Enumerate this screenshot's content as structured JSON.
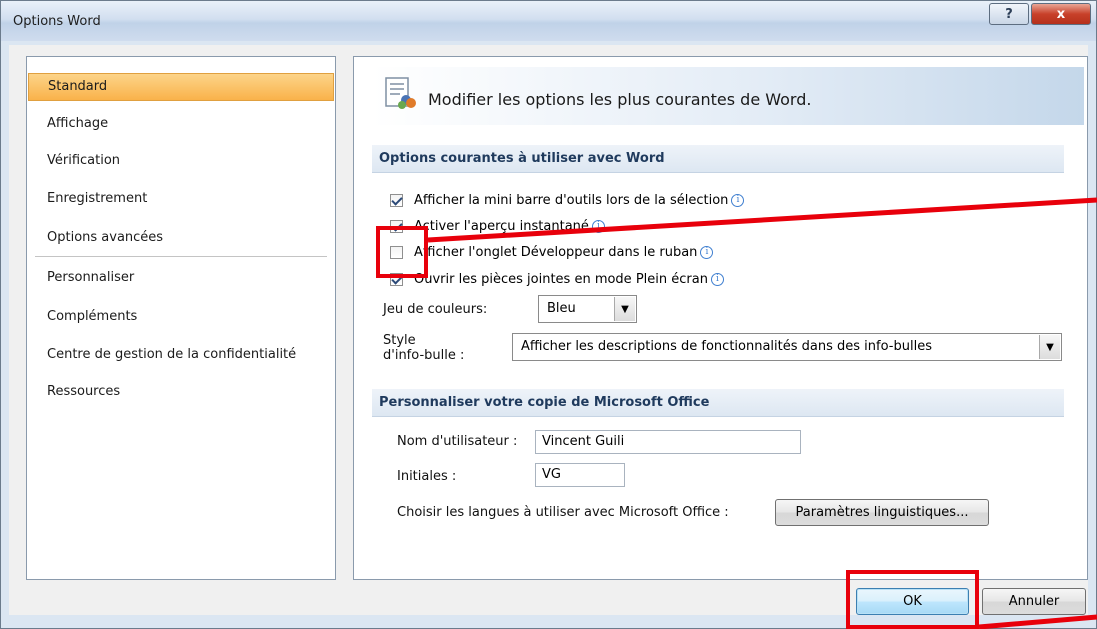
{
  "window": {
    "title": "Options Word",
    "help_glyph": "?",
    "close_glyph": "x"
  },
  "nav": {
    "items": [
      {
        "label": "Standard",
        "selected": true
      },
      {
        "label": "Affichage"
      },
      {
        "label": "Vérification"
      },
      {
        "label": "Enregistrement"
      },
      {
        "label": "Options avancées"
      },
      {
        "label": "Personnaliser"
      },
      {
        "label": "Compléments"
      },
      {
        "label": "Centre de gestion de la confidentialité"
      },
      {
        "label": "Ressources"
      }
    ]
  },
  "content": {
    "header_text": "Modifier les options les plus courantes de Word.",
    "section1": {
      "title": "Options courantes à utiliser avec Word",
      "checkboxes": [
        {
          "label": "Afficher la mini barre d'outils lors de la sélection",
          "checked": true
        },
        {
          "label": "Activer l'aperçu instantané",
          "checked": true
        },
        {
          "label": "Afficher l'onglet Développeur dans le ruban",
          "checked": false
        },
        {
          "label": "Ouvrir les pièces jointes en mode Plein écran",
          "checked": true
        }
      ],
      "color_scheme_label": "Jeu de couleurs:",
      "color_scheme_value": "Bleu",
      "tooltip_style_label_1": "Style",
      "tooltip_style_label_2": "d'info-bulle :",
      "tooltip_style_value": "Afficher les descriptions de fonctionnalités dans des info-bulles"
    },
    "section2": {
      "title": "Personnaliser votre copie de Microsoft Office",
      "username_label": "Nom d'utilisateur :",
      "username_value": "Vincent Guili",
      "initials_label": "Initiales :",
      "initials_value": "VG",
      "languages_label": "Choisir les langues à utiliser avec Microsoft Office :",
      "languages_button": "Paramètres linguistiques..."
    }
  },
  "footer": {
    "ok_label": "OK",
    "cancel_label": "Annuler"
  },
  "colors": {
    "selected_nav": "#f9b24a",
    "annotation_red": "#e8000b",
    "section_header_text": "#1f3a5d"
  }
}
